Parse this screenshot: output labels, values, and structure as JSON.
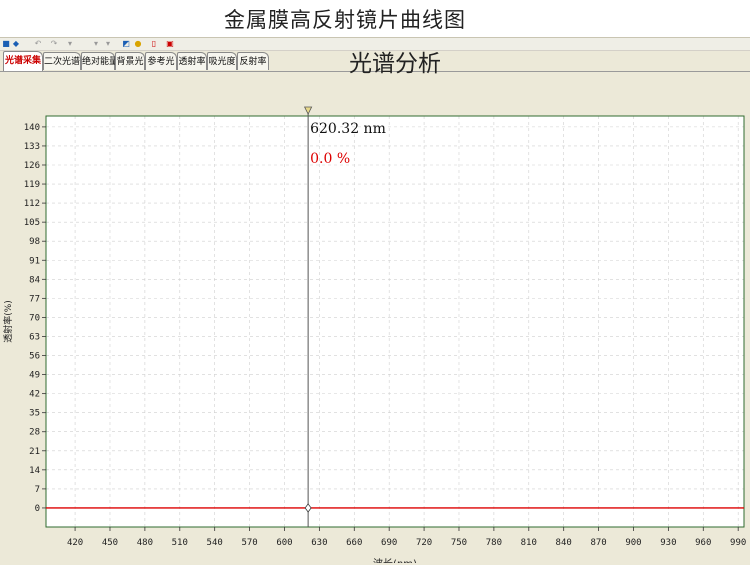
{
  "document_title": "金属膜高反射镜片曲线图",
  "tabs": [
    {
      "label": "光谱采集",
      "active": true
    },
    {
      "label": "二次光谱",
      "active": false
    },
    {
      "label": "绝对能量",
      "active": false
    },
    {
      "label": "背景光",
      "active": false
    },
    {
      "label": "参考光",
      "active": false
    },
    {
      "label": "透射率",
      "active": false
    },
    {
      "label": "吸光度",
      "active": false
    },
    {
      "label": "反射率",
      "active": false
    }
  ],
  "chart_data": {
    "type": "line",
    "title": "光谱分析",
    "ylabel": "透射率(%)",
    "xlabel": "波长(nm)",
    "xlim": [
      395,
      995
    ],
    "ylim": [
      -7,
      144
    ],
    "x_ticks": [
      420,
      450,
      480,
      510,
      540,
      570,
      600,
      630,
      660,
      690,
      720,
      750,
      780,
      810,
      840,
      870,
      900,
      930,
      960,
      990
    ],
    "y_ticks": [
      0,
      7,
      14,
      21,
      28,
      35,
      42,
      49,
      56,
      63,
      70,
      77,
      84,
      91,
      98,
      105,
      112,
      119,
      126,
      133,
      140
    ],
    "grid": true,
    "series": [
      {
        "color": "#dd0000",
        "x": [
          395,
          995
        ],
        "y": [
          0,
          0
        ]
      }
    ],
    "cursor": {
      "x": 620.32,
      "x_label": "620.32 nm",
      "y_label": "0.0 %"
    }
  },
  "colors": {
    "frame": "#2f6b2f",
    "grid": "#cfcfcf",
    "series": "#dd0000",
    "cursor": "#555555",
    "cursor_value": "#dd0000"
  }
}
